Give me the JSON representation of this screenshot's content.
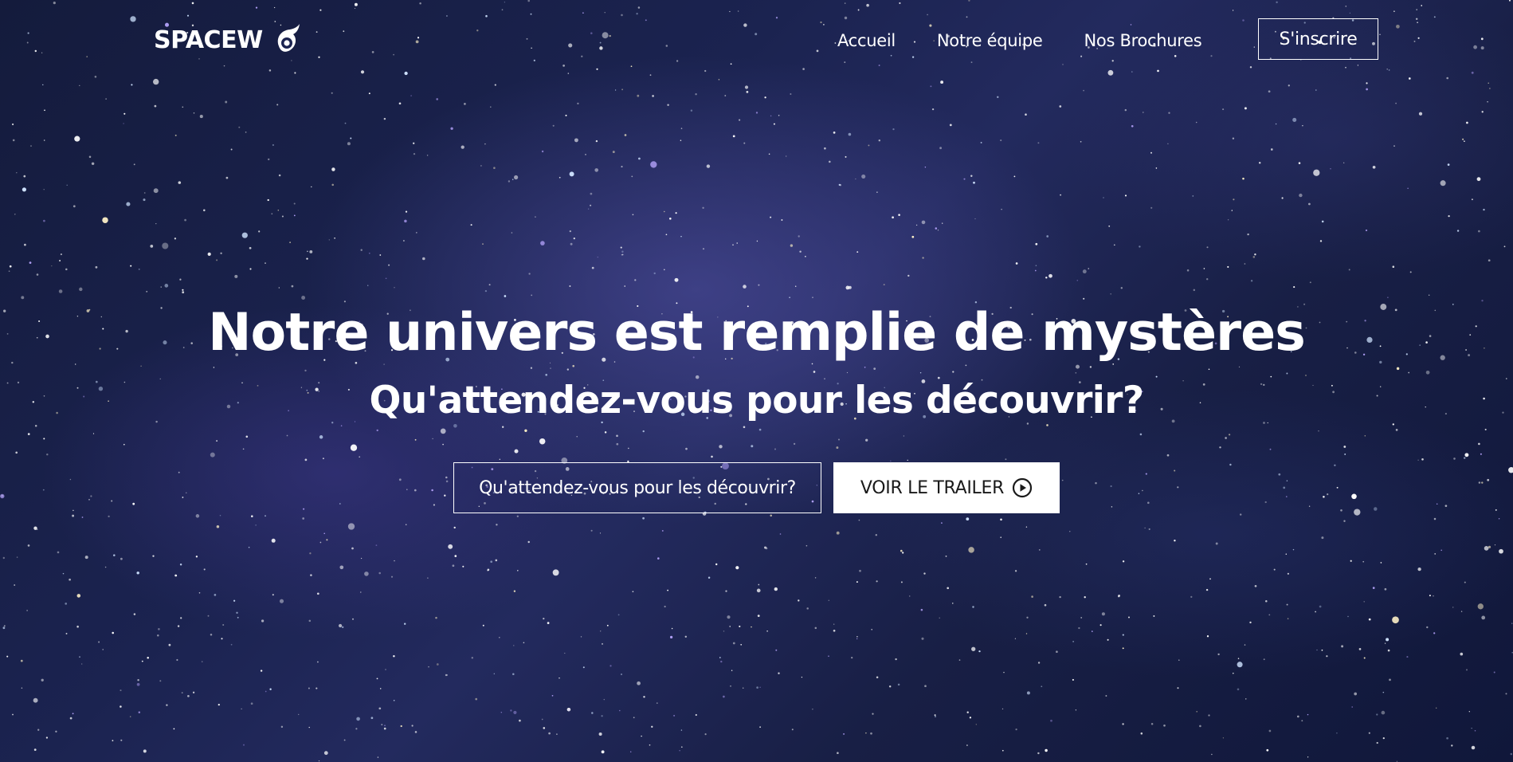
{
  "brand": {
    "name": "SPACEW",
    "logo_icon": "comet-eye-icon"
  },
  "nav": {
    "items": [
      {
        "label": "Accueil"
      },
      {
        "label": "Notre équipe"
      },
      {
        "label": "Nos Brochures"
      }
    ],
    "signup_label": "S'inscrire"
  },
  "hero": {
    "title": "Notre univers est remplie de mystères",
    "subtitle": "Qu'attendez-vous pour les découvrir?",
    "primary_button": "Qu'attendez-vous pour les découvrir?",
    "trailer_button": "VOIR LE TRAILER",
    "trailer_icon": "play-circle-icon"
  },
  "colors": {
    "text": "#ffffff",
    "background": "#1b2350",
    "button_solid_bg": "#ffffff",
    "button_solid_text": "#1a1a1a"
  }
}
